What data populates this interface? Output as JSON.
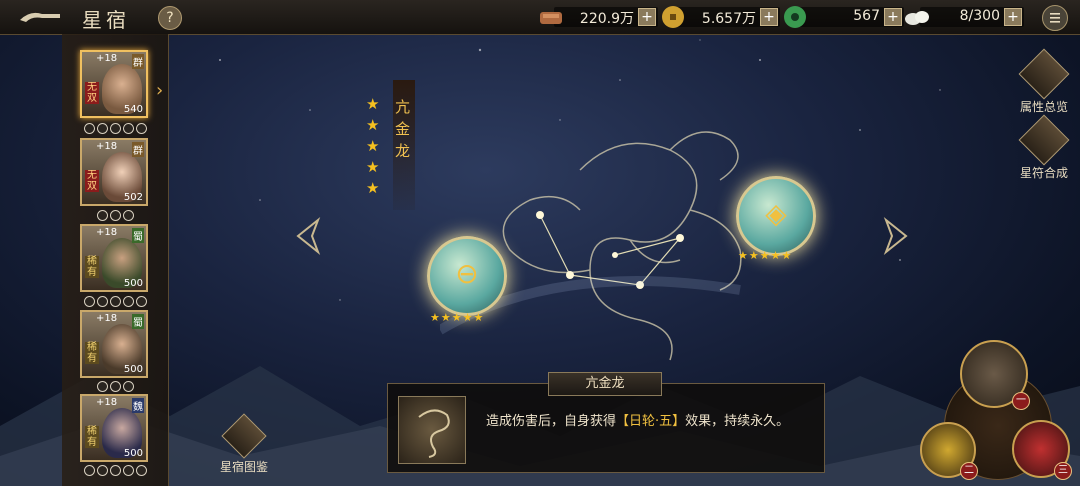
{
  "header": {
    "title": "星宿",
    "help_label": "?",
    "resources": [
      {
        "name": "copper",
        "icon": "copper-ingot-icon",
        "value": "220.9万",
        "plus": "+"
      },
      {
        "name": "coin",
        "icon": "coin-icon",
        "value": "5.657万",
        "plus": "+"
      },
      {
        "name": "jade",
        "icon": "jade-icon",
        "value": "567",
        "plus": "+"
      },
      {
        "name": "stamina",
        "icon": "stamina-icon",
        "value": "8/300",
        "plus": "+"
      }
    ]
  },
  "heroes": [
    {
      "level": "+18",
      "faction": "群",
      "tag": "无双",
      "power": "540",
      "selected": true,
      "slots": 5
    },
    {
      "level": "+18",
      "faction": "群",
      "tag": "无双",
      "power": "502",
      "selected": false,
      "slots": 3
    },
    {
      "level": "+18",
      "faction": "蜀",
      "tag": "稀有",
      "power": "500",
      "selected": false,
      "slots": 5
    },
    {
      "level": "+18",
      "faction": "蜀",
      "tag": "稀有",
      "power": "500",
      "selected": false,
      "slots": 3
    },
    {
      "level": "+18",
      "faction": "魏",
      "tag": "稀有",
      "power": "500",
      "selected": false,
      "slots": 5
    }
  ],
  "constellation": {
    "name": "亢金龙",
    "stars": [
      "★",
      "★",
      "★",
      "★",
      "★"
    ],
    "star_count": 5,
    "orbs": [
      {
        "symbol": "⊖",
        "stars": "★★★★★"
      },
      {
        "symbol": "◈",
        "stars": "★★★★★"
      }
    ]
  },
  "actions": [
    {
      "label": "属性总览",
      "icon": "attributes-overview-icon"
    },
    {
      "label": "星符合成",
      "icon": "star-rune-synthesis-icon"
    }
  ],
  "gallery": {
    "label": "星宿图鉴"
  },
  "info": {
    "title": "亢金龙",
    "desc_pre": "造成伤害后，自身获得",
    "desc_hl": "【日轮·五】",
    "desc_post": "效果，持续永久。"
  },
  "selector": {
    "badges": [
      "一",
      "二",
      "三"
    ]
  },
  "colors": {
    "gold": "#f0c040",
    "accent_red": "#8b1c1c",
    "bg_dark": "#0d1426"
  }
}
